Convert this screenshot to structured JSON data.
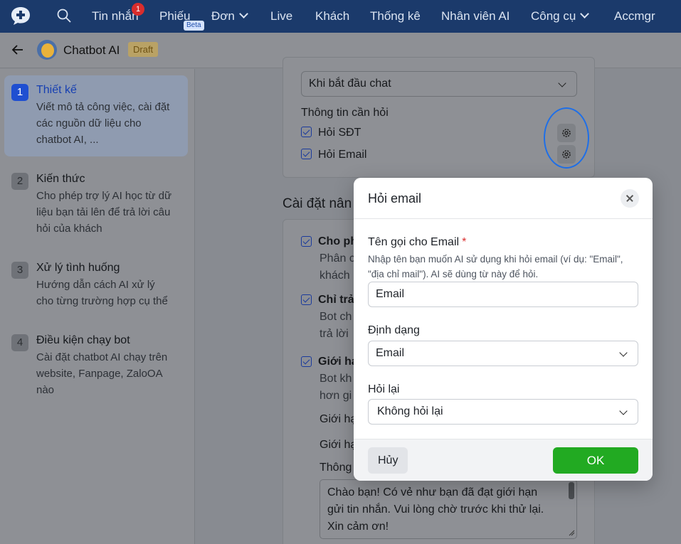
{
  "nav": {
    "items": [
      {
        "label": "Tin nhắn",
        "has_chevron": false
      },
      {
        "label": "Phiếu",
        "has_chevron": false
      },
      {
        "label": "Đơn",
        "has_chevron": true
      },
      {
        "label": "Live",
        "has_chevron": false
      },
      {
        "label": "Khách",
        "has_chevron": false
      },
      {
        "label": "Thống kê",
        "has_chevron": false
      },
      {
        "label": "Nhân viên AI",
        "has_chevron": false
      },
      {
        "label": "Công cụ",
        "has_chevron": true
      },
      {
        "label": "Accmgr",
        "has_chevron": false
      }
    ],
    "messages_badge": "1",
    "tickets_tag": "Beta"
  },
  "header": {
    "title": "Chatbot AI",
    "status": "Draft"
  },
  "sidebar": {
    "steps": [
      {
        "num": "1",
        "title": "Thiết kế",
        "desc_lines": [
          "Viết mô tả công việc, cài đặt",
          "các nguồn dữ liệu cho",
          "chatbot AI, ..."
        ],
        "active": true
      },
      {
        "num": "2",
        "title": "Kiến thức",
        "desc_lines": [
          "Cho phép trợ lý AI học từ dữ",
          "liệu bạn tải lên để trả lời câu",
          "hỏi của khách"
        ],
        "active": false
      },
      {
        "num": "3",
        "title": "Xử lý tình huống",
        "desc_lines": [
          "Hướng dẫn cách AI xử lý",
          "cho từng trường hợp cụ thể"
        ],
        "active": false
      },
      {
        "num": "4",
        "title": "Điều kiện chạy bot",
        "desc_lines": [
          "Cài đặt chatbot AI chạy trên",
          "website, Fanpage, ZaloOA",
          "nào"
        ],
        "active": false
      }
    ]
  },
  "background": {
    "trigger_select_value": "Khi bắt đầu chat",
    "info_heading": "Thông tin cần hỏi",
    "ask_phone": "Hỏi SĐT",
    "ask_email": "Hỏi Email",
    "advanced_heading": "Cài đặt nân",
    "opt1_title": "Cho ph",
    "opt1_desc_1": "Phân c",
    "opt1_desc_2": "khách",
    "opt2_title": "Chỉ trả",
    "opt2_desc_1": "Bot ch",
    "opt2_desc_2": "trả lời",
    "opt3_title": "Giới hạ",
    "opt3_desc_1": "Bot kh",
    "opt3_desc_2": "hơn gi",
    "limit1": "Giới hạ",
    "limit2": "Giới hạ",
    "msg_label": "Thông",
    "message_text": "Chào bạn! Có vẻ như bạn đã đạt giới hạn gửi tin nhắn. Vui lòng chờ trước khi thử lại. Xin cảm ơn!"
  },
  "modal": {
    "title": "Hỏi email",
    "name_label": "Tên gọi cho Email",
    "required_mark": "*",
    "hint": "Nhập tên bạn muốn AI sử dụng khi hỏi email (ví dụ: \"Email\", \"địa chỉ mail\"). AI sẽ dùng từ này để hỏi.",
    "name_value": "Email",
    "format_label": "Định dạng",
    "format_value": "Email",
    "reask_label": "Hỏi lại",
    "reask_value": "Không hỏi lại",
    "cancel_label": "Hủy",
    "ok_label": "OK"
  },
  "colors": {
    "nav_bg": "#1b3a6b",
    "accent_blue": "#1f4fd1",
    "ok_green": "#22aa22",
    "highlight_ring": "#1e6fe8"
  }
}
